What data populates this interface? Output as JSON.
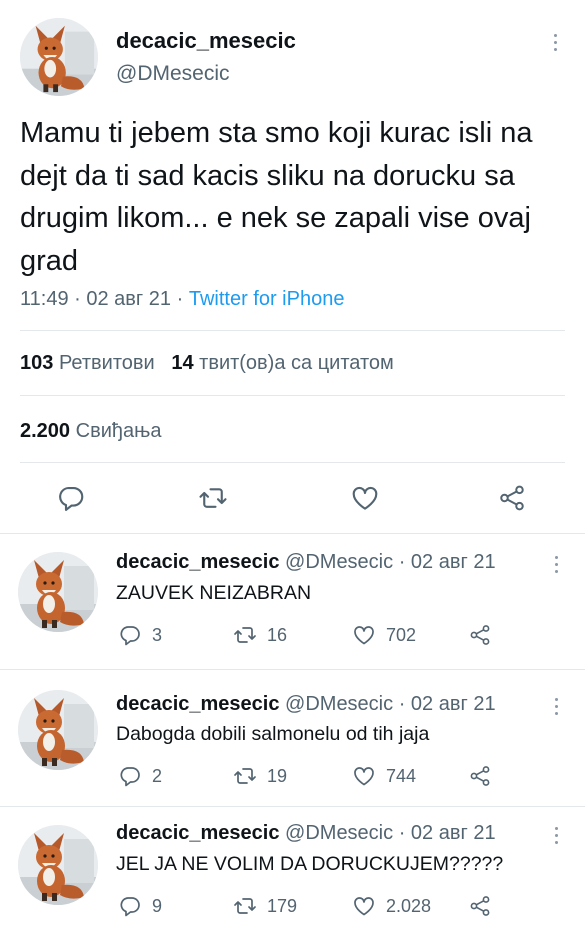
{
  "tweet": {
    "display_name": "decacic_mesecic",
    "handle": "@DMesecic",
    "text": "Mamu ti jebem sta smo koji kurac isli na dejt da ti sad kacis sliku na dorucku sa drugim likom... e nek se zapali vise ovaj grad",
    "time": "11:49",
    "separator": "·",
    "date": "02 авг 21",
    "source": "Twitter for iPhone",
    "retweets_count": "103",
    "retweets_label": "Ретвитови",
    "quotes_count": "14",
    "quotes_label": "твит(ов)а са цитатом",
    "likes_count": "2.200",
    "likes_label": "Свиђања"
  },
  "icons": {
    "reply": "reply-icon",
    "retweet": "retweet-icon",
    "like": "heart-icon",
    "share": "share-icon",
    "more": "more-vertical-icon",
    "avatar": "fox-avatar"
  },
  "colors": {
    "link": "#1d9bf0",
    "muted": "#536471",
    "text": "#0f1419",
    "divider": "#e4e8eb"
  },
  "replies": [
    {
      "display_name": "decacic_mesecic",
      "handle": "@DMesecic",
      "date": "· 02 авг 21",
      "text": "ZAUVEK NEIZABRAN",
      "reply_count": "3",
      "retweet_count": "16",
      "like_count": "702"
    },
    {
      "display_name": "decacic_mesecic",
      "handle": "@DMesecic",
      "date": "· 02 авг 21",
      "text": "Dabogda dobili salmonelu od tih jaja",
      "reply_count": "2",
      "retweet_count": "19",
      "like_count": "744"
    },
    {
      "display_name": "decacic_mesecic",
      "handle": "@DMesecic",
      "date": "· 02 авг 21",
      "text": "JEL JA NE VOLIM DA DORUCKUJEM?????",
      "reply_count": "9",
      "retweet_count": "179",
      "like_count": "2.028"
    }
  ]
}
